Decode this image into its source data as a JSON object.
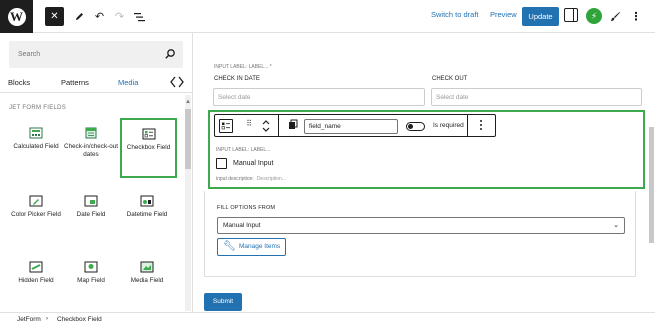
{
  "toolbar": {
    "switch_to_draft": "Switch to draft",
    "preview": "Preview",
    "update": "Update",
    "icons": [
      "wordpress-logo",
      "close",
      "pencil",
      "undo",
      "redo",
      "list-view",
      "settings-panel",
      "jetplugins-bolt",
      "brush",
      "more-vertical"
    ]
  },
  "sidebar": {
    "search_placeholder": "Search",
    "tabs": [
      {
        "label": "Blocks"
      },
      {
        "label": "Patterns"
      },
      {
        "label": "Media"
      }
    ],
    "category_title": "JET FORM FIELDS",
    "items": [
      {
        "label": "Calculated Field",
        "icon": "calculator"
      },
      {
        "label": "Check-in/check-out dates",
        "icon": "calendar"
      },
      {
        "label": "Checkbox Field",
        "icon": "checkbox-list",
        "selected": true
      },
      {
        "label": "Color Picker Field",
        "icon": "color-picker"
      },
      {
        "label": "Date Field",
        "icon": "date"
      },
      {
        "label": "Datetime Field",
        "icon": "datetime"
      },
      {
        "label": "Hidden Field",
        "icon": "hidden"
      },
      {
        "label": "Map Field",
        "icon": "map"
      },
      {
        "label": "Media Field",
        "icon": "media"
      }
    ]
  },
  "canvas": {
    "top_input_label": "INPUT LABEL:  LABEL... *",
    "checkin_label": "CHECK IN DATE",
    "checkout_label": "CHECK OUT",
    "checkin_placeholder": "Select date",
    "checkout_placeholder": "Select date",
    "block": {
      "field_name": "field_name",
      "is_required": "Is required",
      "input_label": "INPUT LABEL:  LABEL...",
      "option_label": "Manual Input",
      "description_label": "input description:",
      "description_placeholder": "Description..."
    },
    "fill_options": {
      "title": "FILL OPTIONS FROM",
      "selected": "Manual Input",
      "manage_button": "Manage Items"
    },
    "submit": "Submit"
  },
  "footer": {
    "breadcrumb": [
      "JetForm",
      "Checkbox Field"
    ]
  },
  "colors": {
    "accent": "#2271b1",
    "selection": "#3daa4f",
    "dark": "#1e1e1e"
  }
}
